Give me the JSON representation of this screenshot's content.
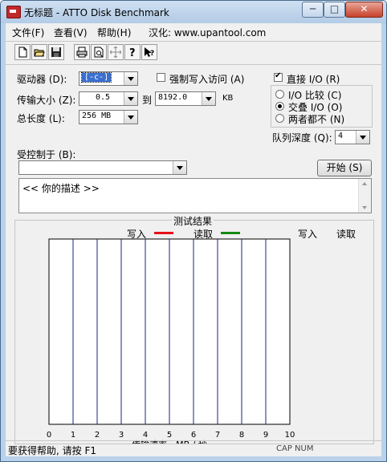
{
  "window": {
    "title": "无标题 - ATTO Disk Benchmark",
    "minimize": "─",
    "maximize": "□",
    "close": "✕"
  },
  "menu": [
    "文件(F)",
    "查看(V)",
    "帮助(H)",
    "汉化: www.upantool.com"
  ],
  "toolbar": [
    "new-icon",
    "open-icon",
    "save-icon",
    "print-icon",
    "print-preview-icon",
    "move-icon",
    "help-icon",
    "context-help-icon"
  ],
  "drive": {
    "label": "驱动器 (D):",
    "value": "[-c-]"
  },
  "force_write": {
    "label": "强制写入访问 (A)",
    "checked": false
  },
  "direct_io": {
    "label": "直接 I/O (R)",
    "checked": true
  },
  "transfer_size": {
    "label": "传输大小 (Z):",
    "from": "0.5",
    "to_label": "到",
    "to": "8192.0",
    "unit": "KB"
  },
  "total_length": {
    "label": "总长度 (L):",
    "value": "256 MB"
  },
  "io_mode": {
    "options": [
      "I/O 比较 (C)",
      "交叠 I/O (O)",
      "两者都不 (N)"
    ],
    "selected": 1
  },
  "queue_depth": {
    "label": "队列深度 (Q):",
    "value": "4"
  },
  "controlled_by": {
    "label": "受控制于 (B):",
    "value": ""
  },
  "start_button": "开始 (S)",
  "description": "<<  你的描述   >>",
  "results": {
    "title": "测试结果",
    "legend_write": "写入",
    "legend_read": "读取",
    "col_write": "写入",
    "col_read": "读取"
  },
  "chart_data": {
    "type": "bar",
    "title": "测试结果",
    "xlabel": "传输速率 - MB / 秒",
    "ylabel": "",
    "xlim": [
      0,
      10
    ],
    "x_ticks": [
      "0",
      "1",
      "2",
      "3",
      "4",
      "5",
      "6",
      "7",
      "8",
      "9",
      "10"
    ],
    "series": [
      {
        "name": "写入",
        "values": [],
        "color": "#e8101a"
      },
      {
        "name": "读取",
        "values": [],
        "color": "#138a13"
      }
    ],
    "grid": true
  },
  "status": {
    "text": "要获得帮助, 请按 F1",
    "indicators": "CAP  NUM"
  },
  "colors": {
    "titlebar": "#b9d1ea",
    "grid_line": "#1a237e",
    "write": "#e8101a",
    "read": "#138a13"
  }
}
